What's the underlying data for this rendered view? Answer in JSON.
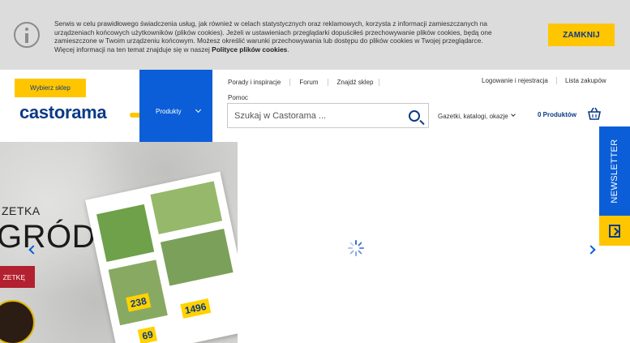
{
  "cookie_bar": {
    "text_line1": "Serwis w celu prawidłowego świadczenia usług, jak również w celach statystycznych oraz reklamowych, korzysta z informacji zamieszczanych na",
    "text_line2": "urządzeniach końcowych użytkowników (plików cookies). Jeżeli w ustawieniach przeglądarki dopuściłeś przechowywanie plików cookies, będą one",
    "text_line3": "zamieszczone w Twoim urządzeniu końcowym. Możesz określić warunki przechowywania lub dostępu do plików cookies w Twojej przeglądarce.",
    "text_line4_prefix": "Więcej informacji na ten temat znajduje się w naszej ",
    "policy_link": "Polityce plików cookies",
    "text_line4_suffix": ".",
    "close_label": "ZAMKNIJ",
    "info_icon": "info-icon"
  },
  "header": {
    "store_button": "Wybierz sklep",
    "logo": "castorama",
    "products_tab": "Produkty",
    "top_links": [
      "Porady i inspiracje",
      "Forum",
      "Znajdź sklep"
    ],
    "help_link": "Pomoc",
    "login_link": "Logowanie i rejestracja",
    "list_link": "Lista zakupów",
    "search_placeholder": "Szukaj w Castorama ...",
    "gazetki_link": "Gazetki, katalogi, okazje",
    "cart_label": "0 Produktów",
    "brand_blue": "#0b5ed7",
    "brand_yellow": "#ffc600"
  },
  "hero": {
    "eyebrow": "ZETKA",
    "title": "GRÓD",
    "cta": "ZETKĘ",
    "prices": [
      "238",
      "1496",
      "69"
    ]
  },
  "newsletter": {
    "label": "NEWSLETTER"
  }
}
